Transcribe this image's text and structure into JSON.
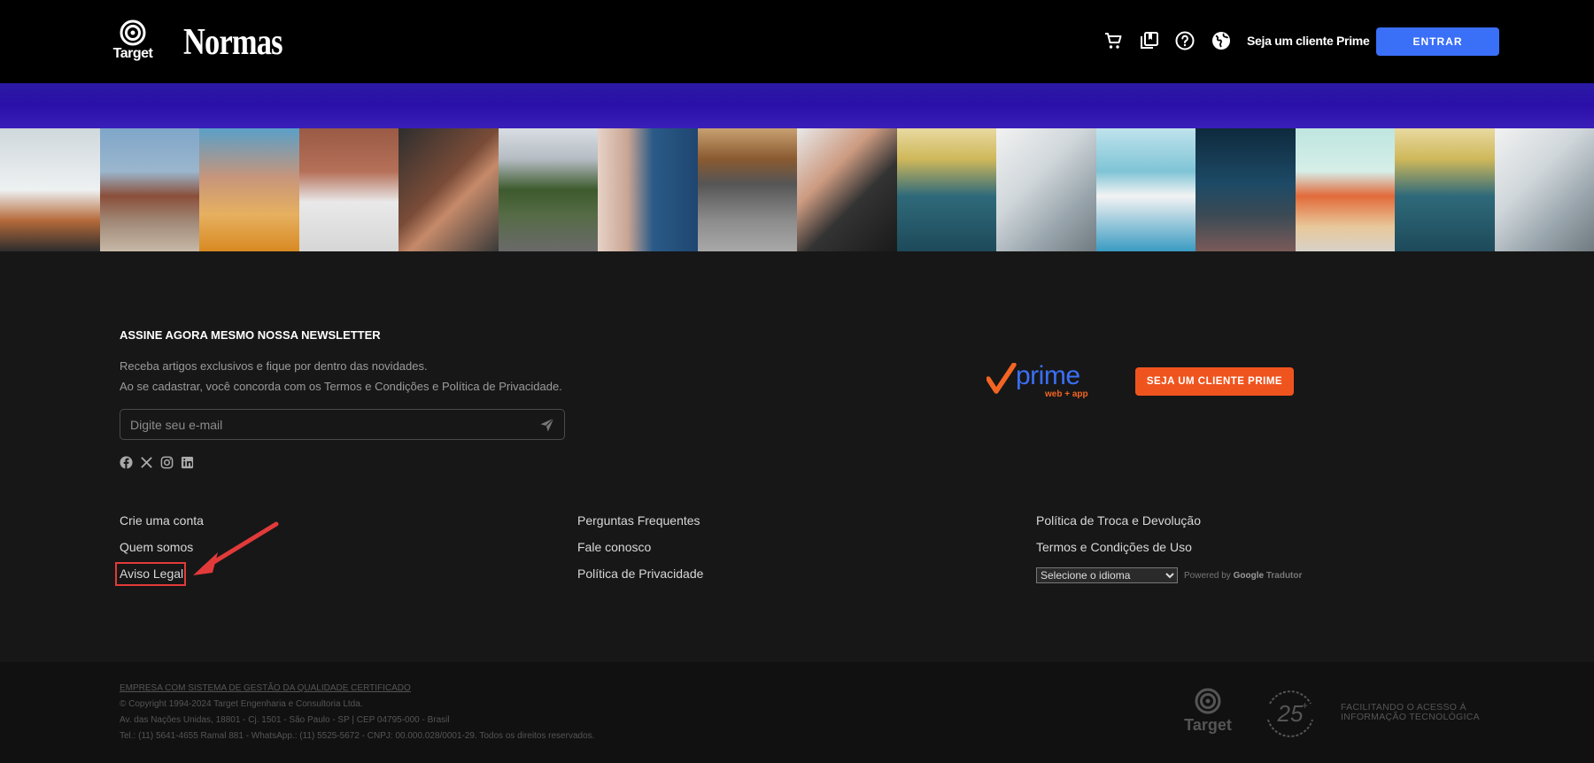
{
  "header": {
    "logo_target": "Target",
    "logo_normas": "Normas",
    "icons": [
      "cart-icon",
      "library-icon",
      "help-icon",
      "globe-icon"
    ],
    "prime_link": "Seja um cliente Prime",
    "login_button": "ENTRAR"
  },
  "newsletter": {
    "title": "ASSINE AGORA MESMO NOSSA NEWSLETTER",
    "line1": "Receba artigos exclusivos e fique por dentro das novidades.",
    "line2": "Ao se cadastrar, você concorda com os Termos e Condições e Política de Privacidade.",
    "email_placeholder": "Digite seu e-mail",
    "socials": [
      "facebook-icon",
      "x-icon",
      "instagram-icon",
      "linkedin-icon"
    ]
  },
  "prime": {
    "logo_word": "prime",
    "logo_sub": "web + app",
    "button": "SEJA UM CLIENTE PRIME"
  },
  "links": {
    "col1": [
      "Crie uma conta",
      "Quem somos",
      "Aviso Legal"
    ],
    "col2": [
      "Perguntas Frequentes",
      "Fale conosco",
      "Política de Privacidade"
    ],
    "col3": [
      "Política de Troca e Devolução",
      "Termos e Condições de Uso"
    ]
  },
  "translate": {
    "select_value": "Selecione o idioma",
    "powered": "Powered by",
    "google": "Google",
    "tradutor": "Tradutor"
  },
  "bottom": {
    "cert": "EMPRESA COM SISTEMA DE GESTÃO DA QUALIDADE CERTIFICADO",
    "copyright": "© Copyright 1994-2024 Target Engenharia e Consultoria Ltda.",
    "address": "Av. das Nações Unidas, 18801 - Cj. 1501 - São Paulo - SP | CEP 04795-000 - Brasil",
    "contact": "Tel.: (11) 5641-4655 Ramal 881 - WhatsApp.: (11) 5525-5672 - CNPJ: 00.000.028/0001-29. Todos os direitos reservados.",
    "logo_target": "Target",
    "badge_25": "25",
    "slogan1": "FACILITANDO O ACESSO À",
    "slogan2": "INFORMAÇÃO TECNOLÓGICA"
  },
  "colors": {
    "accent_blue": "#3a6ff7",
    "prime_orange": "#f0541e",
    "banner_purple": "#2a0fa8",
    "highlight_red": "#e23a3a"
  }
}
